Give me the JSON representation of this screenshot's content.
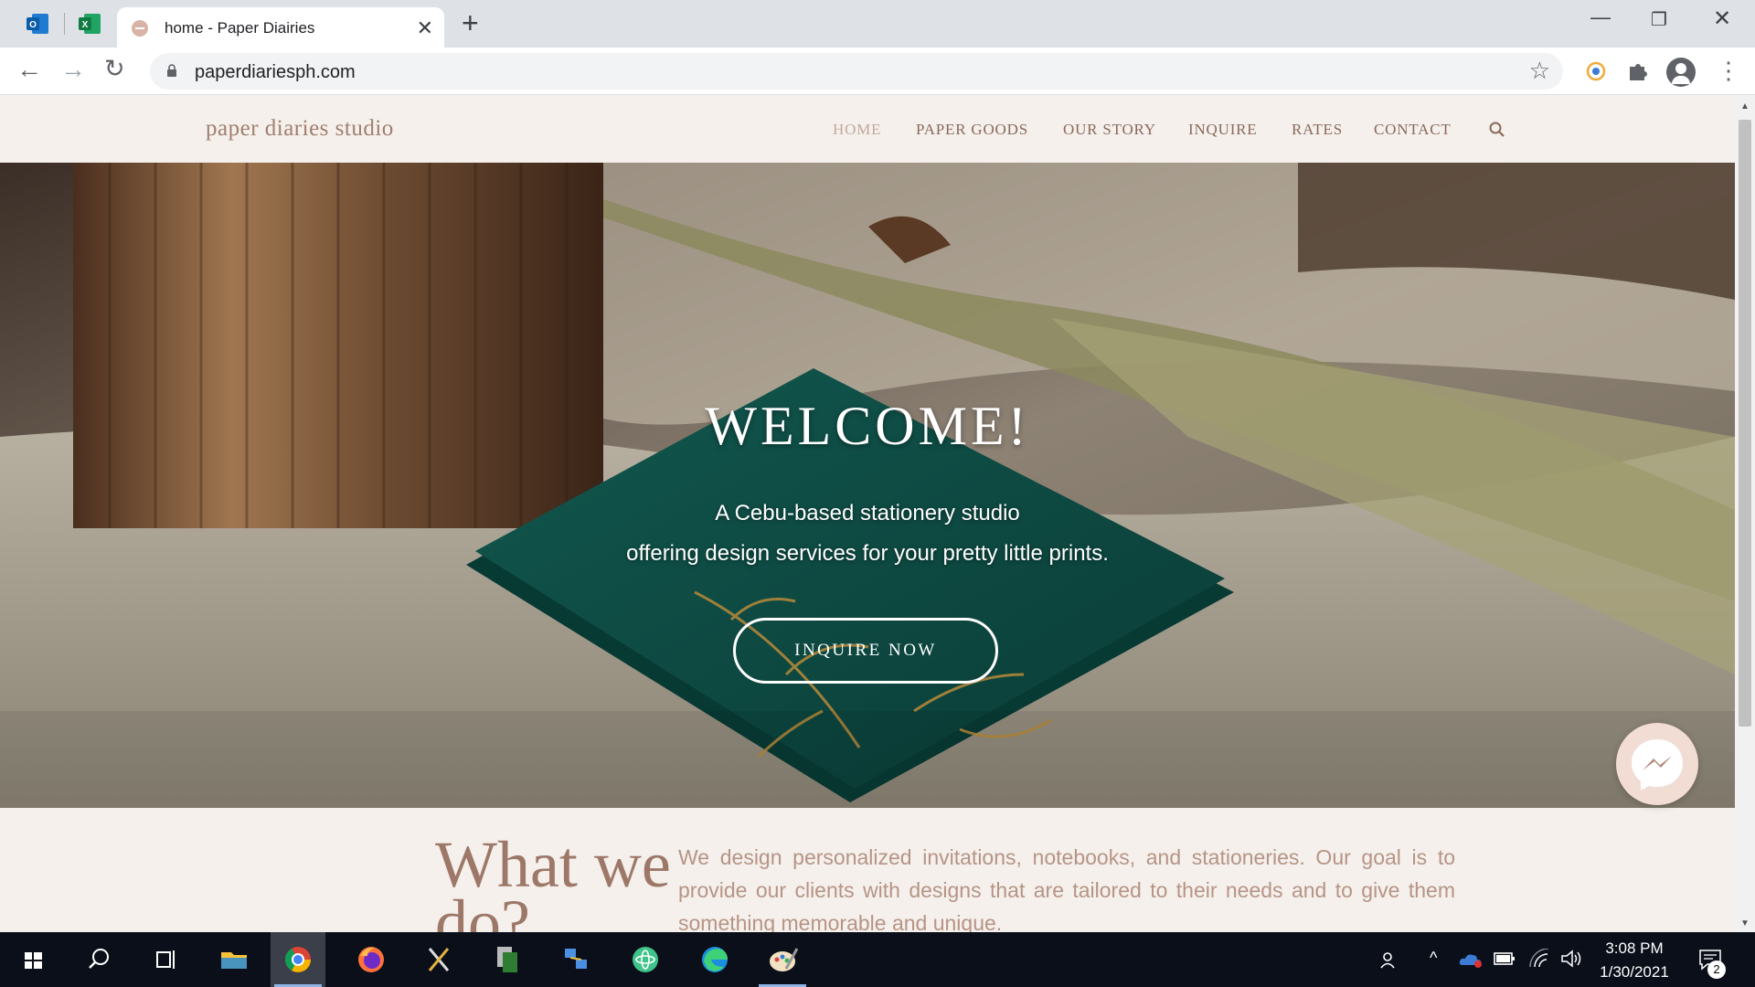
{
  "browser": {
    "tab_title": "home - Paper Diairies",
    "tab_close": "✕",
    "new_tab": "+",
    "url": "paperdiariesph.com",
    "window_controls": {
      "minimize": "—",
      "maximize": "❐",
      "close": "✕"
    },
    "nav": {
      "back": "←",
      "forward": "→",
      "reload": "↻",
      "star": "☆",
      "menu": "⋮"
    }
  },
  "site": {
    "logo": "paper diaries studio",
    "nav_items": [
      "HOME",
      "PAPER GOODS",
      "OUR STORY",
      "INQUIRE",
      "RATES",
      "CONTACT"
    ],
    "active_nav": "HOME",
    "hero": {
      "title": "WELCOME!",
      "line1": "A Cebu-based stationery studio",
      "line2": "offering design services for your pretty little prints.",
      "button": "INQUIRE NOW"
    },
    "about": {
      "title": "What we do?",
      "text": "We design personalized invitations, notebooks, and stationeries. Our goal is to provide our clients with designs that are tailored to their needs and to give them something memorable and unique."
    }
  },
  "taskbar": {
    "time": "3:08 PM",
    "date": "1/30/2021",
    "notifications": "2",
    "icons": [
      "start-icon",
      "search-icon",
      "task-view-icon",
      "file-explorer-icon",
      "chrome-icon",
      "firefox-icon",
      "app-x-icon",
      "files-app-icon",
      "network-app-icon",
      "atom-icon",
      "edge-icon",
      "paint-icon"
    ]
  },
  "colors": {
    "accent": "#a07f6f",
    "nav_text": "#8a6a5c",
    "nav_active": "#c3a89b",
    "page_bg": "#f5f0ec",
    "hero_card": "#0e4f47"
  }
}
